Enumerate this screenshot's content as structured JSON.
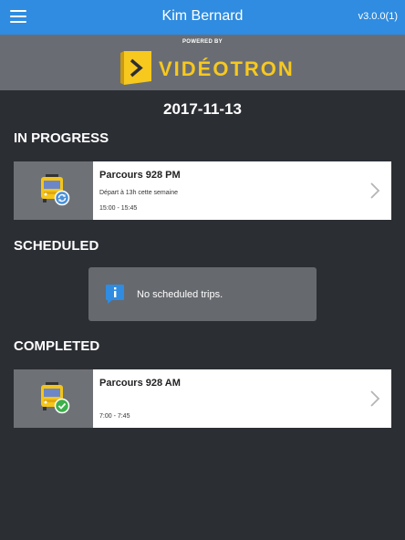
{
  "header": {
    "title": "Kim Bernard",
    "version": "v3.0.0(1)"
  },
  "branding": {
    "powered_by": "POWERED BY",
    "logo_text": "VIDÉOTRON",
    "accent_color": "#f7c81e"
  },
  "date": "2017-11-13",
  "sections": {
    "in_progress": "IN PROGRESS",
    "scheduled": "SCHEDULED",
    "completed": "COMPLETED"
  },
  "in_progress_trip": {
    "name": "Parcours 928 PM",
    "description": "Départ à 13h cette semaine",
    "time": "15:00 - 15:45",
    "status_icon": "sync-icon"
  },
  "scheduled_empty": {
    "message": "No scheduled trips.",
    "icon": "info-icon"
  },
  "completed_trip": {
    "name": "Parcours 928 AM",
    "time": "7:00 - 7:45",
    "status_icon": "check-icon"
  },
  "colors": {
    "topbar": "#2f8ce0",
    "background": "#2b2e33",
    "check": "#3cb04a"
  }
}
